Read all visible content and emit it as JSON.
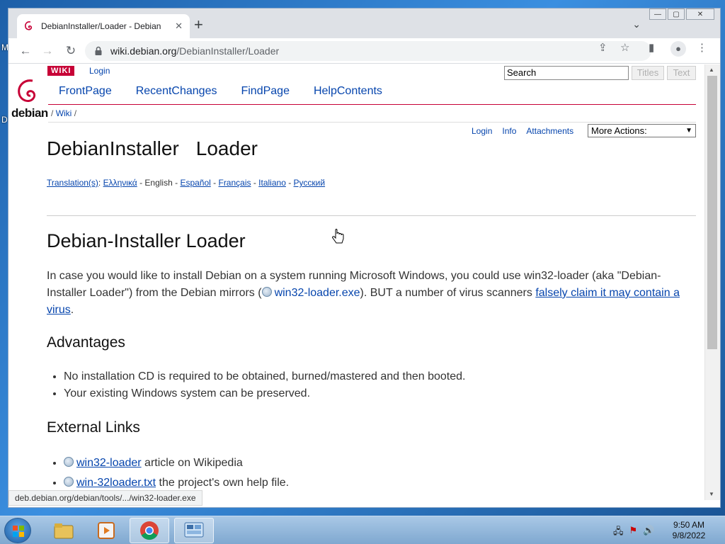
{
  "browser": {
    "tab_title": "DebianInstaller/Loader - Debian",
    "new_tab": "+",
    "address_host": "wiki.debian.org",
    "address_path": "/DebianInstaller/Loader",
    "window_controls": {
      "minimize": "—",
      "restore": "▢",
      "close": "✕"
    }
  },
  "wiki": {
    "badge": "WIKI",
    "login": "Login",
    "search_value": "Search",
    "titles_button": "Titles",
    "text_button": "Text",
    "logo_text": "debian",
    "nav": [
      "FrontPage",
      "RecentChanges",
      "FindPage",
      "HelpContents"
    ],
    "breadcrumb_sep": "/",
    "breadcrumb_wiki": "Wiki",
    "breadcrumb_end": "/",
    "page_actions": [
      "Login",
      "Info",
      "Attachments"
    ],
    "more_actions": "More Actions:"
  },
  "article": {
    "title_part1": "DebianInstaller",
    "title_part2": "Loader",
    "translations_label": "Translation(s)",
    "translations": [
      "Ελληνικά",
      "English",
      "Español",
      "Français",
      "Italiano",
      "Русский"
    ],
    "heading": "Debian-Installer Loader",
    "para_1": "In case you would like to install Debian on a system running Microsoft Windows, you could use win32-loader (aka \"Debian-Installer Loader\") from the Debian mirrors (",
    "para_link": "win32-loader.exe",
    "para_2": "). BUT a number of virus scanners ",
    "para_link2": "falsely claim it may contain a virus",
    "para_end": ".",
    "advantages_heading": "Advantages",
    "advantages": [
      "No installation CD is required to be obtained, burned/mastered and then booted.",
      "Your existing Windows system can be preserved."
    ],
    "links_heading": "External Links",
    "links": [
      {
        "link": "win32-loader",
        "rest": " article on Wikipedia"
      },
      {
        "link": "win-32loader.txt",
        "rest": " the project's own help file."
      }
    ]
  },
  "status_url": "deb.debian.org/debian/tools/.../win32-loader.exe",
  "taskbar": {
    "time": "9:50 AM",
    "date": "9/8/2022"
  },
  "desktop_glyphs": [
    "M",
    "D"
  ],
  "colors": {
    "debian_red": "#c70036",
    "link": "#0645ad"
  }
}
